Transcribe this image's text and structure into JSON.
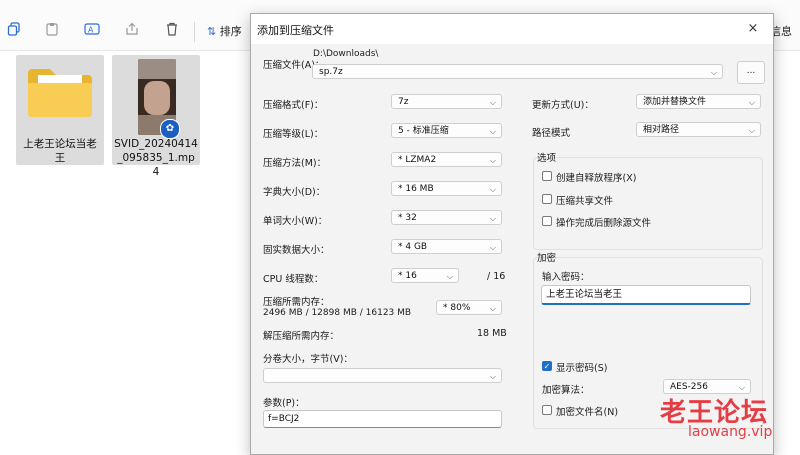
{
  "explorer": {
    "toolbar": {
      "copy_icon": "copy-icon",
      "paste_icon": "paste-icon",
      "rename_icon": "rename-icon",
      "share_icon": "share-icon",
      "delete_icon": "delete-icon",
      "sort_label": "排序",
      "info_label": "信息"
    },
    "files": [
      {
        "name": "上老王论坛当老王",
        "type": "folder"
      },
      {
        "name": "SVID_20240414_095835_1.mp4",
        "type": "video"
      }
    ]
  },
  "dialog": {
    "title": "添加到压缩文件",
    "close_icon": "×",
    "archive_label": "压缩文件(A)：",
    "archive_path": "D:\\Downloads\\",
    "archive_name": "sp.7z",
    "browse_label": "...",
    "left": {
      "format_label": "压缩格式(F)：",
      "format_value": "7z",
      "level_label": "压缩等级(L)：",
      "level_value": "5 - 标准压缩",
      "method_label": "压缩方法(M)：",
      "method_value": "* LZMA2",
      "dict_label": "字典大小(D)：",
      "dict_value": "* 16 MB",
      "word_label": "单词大小(W)：",
      "word_value": "* 32",
      "solid_label": "固实数据大小：",
      "solid_value": "* 4 GB",
      "threads_label": "CPU 线程数：",
      "threads_value": "* 16",
      "threads_total": "/ 16",
      "mem_label": "压缩所需内存：",
      "mem_value": "2496 MB / 12898 MB / 16123 MB",
      "mem_percent": "* 80%",
      "decomp_label": "解压缩所需内存：",
      "decomp_value": "18 MB",
      "split_label": "分卷大小，字节(V)：",
      "split_value": "",
      "params_label": "参数(P)：",
      "params_value": "f=BCJ2"
    },
    "right": {
      "update_label": "更新方式(U)：",
      "update_value": "添加并替换文件",
      "pathmode_label": "路径模式",
      "pathmode_value": "相对路径",
      "options_title": "选项",
      "opt_sfx": "创建自释放程序(X)",
      "opt_shared": "压缩共享文件",
      "opt_delete": "操作完成后删除源文件",
      "encrypt_title": "加密",
      "password_label": "输入密码：",
      "password_value": "上老王论坛当老王",
      "show_password": "显示密码(S)",
      "enc_method_label": "加密算法：",
      "enc_method_value": "AES-256",
      "encrypt_names": "加密文件名(N)"
    }
  },
  "watermark": {
    "cn": "老王论坛",
    "url": "laowang.vip"
  }
}
